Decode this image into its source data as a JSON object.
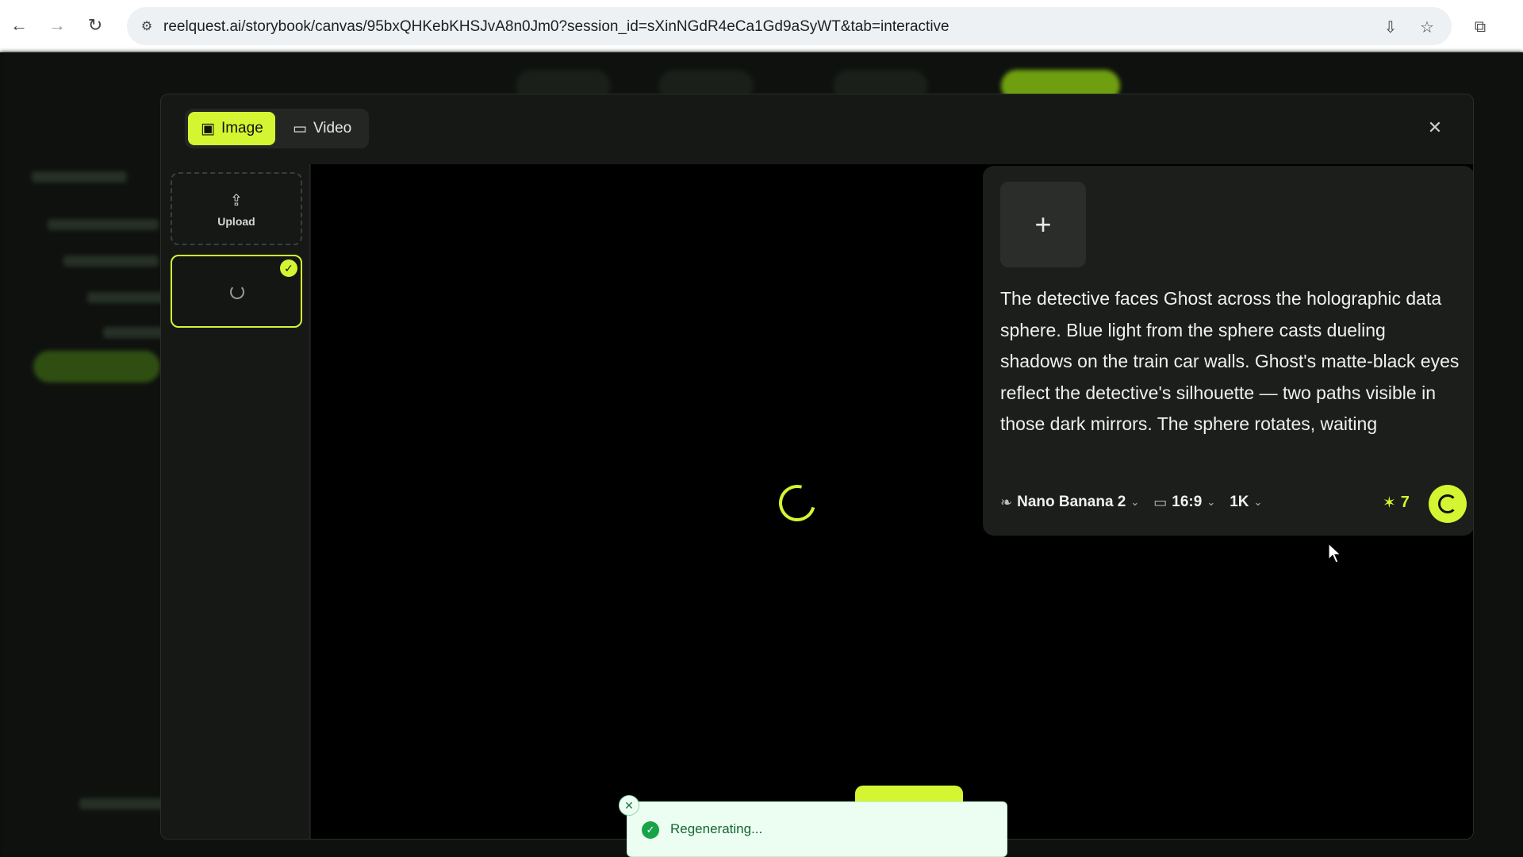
{
  "browser": {
    "url": "reelquest.ai/storybook/canvas/95bxQHKebKHSJvA8n0Jm0?session_id=sXinNGdR4eCa1Gd9aSyWT&tab=interactive"
  },
  "modal": {
    "tabs": [
      {
        "label": "Image",
        "active": true
      },
      {
        "label": "Video",
        "active": false
      }
    ],
    "upload_label": "Upload",
    "prompt": "The detective faces Ghost across the holographic data sphere. Blue light from the sphere casts dueling shadows on the train car walls. Ghost's matte-black eyes reflect the detective's silhouette — two paths visible in those dark mirrors. The sphere rotates, waiting",
    "controls": {
      "model": "Nano Banana 2",
      "aspect_ratio": "16:9",
      "resolution": "1K",
      "credits": "7"
    }
  },
  "toast": {
    "message": "Regenerating..."
  },
  "colors": {
    "accent": "#d4f531",
    "success": "#18a348"
  }
}
